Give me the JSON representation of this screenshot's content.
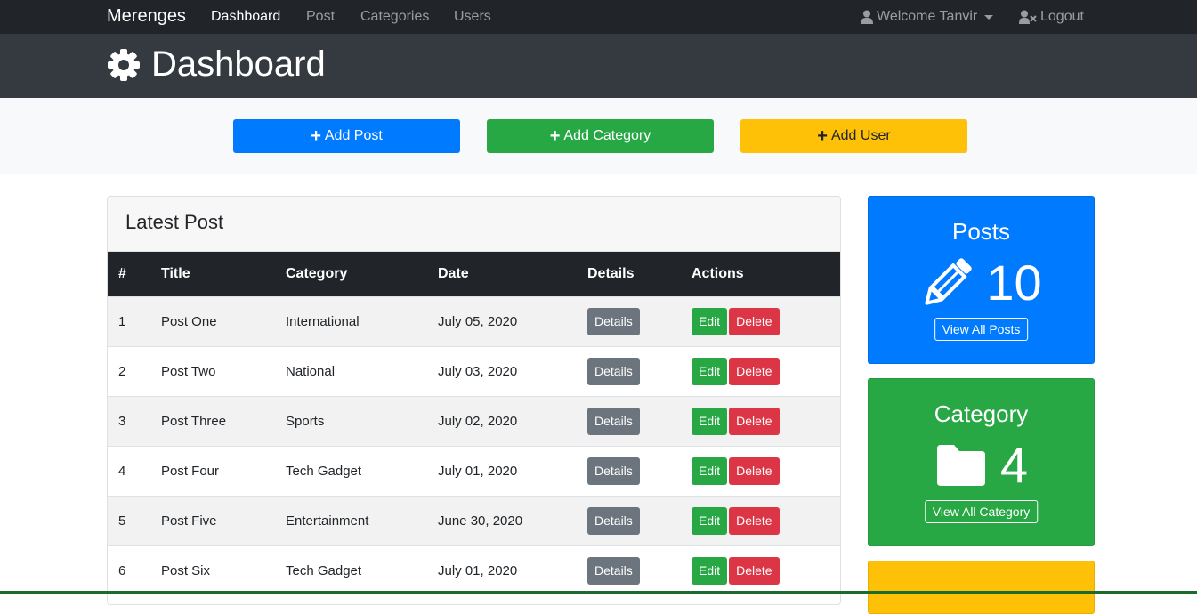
{
  "navbar": {
    "brand": "Merenges",
    "links": [
      "Dashboard",
      "Post",
      "Categories",
      "Users"
    ],
    "welcome": "Welcome Tanvir",
    "logout": "Logout"
  },
  "header": {
    "title": "Dashboard"
  },
  "actions": {
    "add_post": "Add Post",
    "add_category": "Add Category",
    "add_user": "Add User"
  },
  "latest_post": {
    "title": "Latest Post",
    "columns": [
      "#",
      "Title",
      "Category",
      "Date",
      "Details",
      "Actions"
    ],
    "rows": [
      {
        "num": "1",
        "title": "Post One",
        "category": "International",
        "date": "July 05, 2020"
      },
      {
        "num": "2",
        "title": "Post Two",
        "category": "National",
        "date": "July 03, 2020"
      },
      {
        "num": "3",
        "title": "Post Three",
        "category": "Sports",
        "date": "July 02, 2020"
      },
      {
        "num": "4",
        "title": "Post Four",
        "category": "Tech Gadget",
        "date": "July 01, 2020"
      },
      {
        "num": "5",
        "title": "Post Five",
        "category": "Entertainment",
        "date": "June 30, 2020"
      },
      {
        "num": "6",
        "title": "Post Six",
        "category": "Tech Gadget",
        "date": "July 01, 2020"
      }
    ],
    "details_label": "Details",
    "edit_label": "Edit",
    "delete_label": "Delete"
  },
  "stats": {
    "posts": {
      "title": "Posts",
      "count": "10",
      "button": "View All Posts",
      "icon": "pencil-icon"
    },
    "category": {
      "title": "Category",
      "count": "4",
      "button": "View All Category",
      "icon": "folder-icon"
    }
  },
  "colors": {
    "primary": "#007bff",
    "success": "#28a745",
    "warning": "#ffc107",
    "danger": "#dc3545",
    "secondary": "#6c757d",
    "dark": "#212529"
  }
}
